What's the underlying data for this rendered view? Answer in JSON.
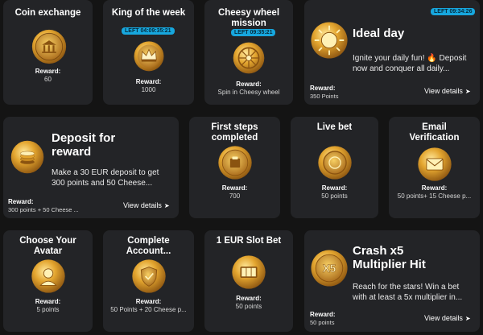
{
  "cards": [
    {
      "title": "Coin exchange",
      "reward_label": "Reward:",
      "reward_value": "60",
      "medal_icon": "bank-medal-icon"
    },
    {
      "title": "King of the week",
      "timer": "LEFT 04:09:35:21",
      "reward_label": "Reward:",
      "reward_value": "1000",
      "medal_icon": "crown-medal-icon"
    },
    {
      "title": "Cheesy wheel mission",
      "timer": "LEFT 09:35:21",
      "reward_label": "Reward:",
      "reward_value": "Spin in Cheesy wheel",
      "medal_icon": "wheel-medal-icon"
    },
    {
      "title": "Ideal day",
      "timer": "LEFT 09:34:26",
      "description": "Ignite your daily fun! 🔥 Deposit now and conquer all daily...",
      "reward_label": "Reward:",
      "reward_value": "350 Points",
      "details": "View details",
      "medal_icon": "sun-medal-icon"
    },
    {
      "title": "Deposit for reward",
      "description": "Make a 30 EUR deposit to get 300 points and 50 Cheese...",
      "reward_label": "Reward:",
      "reward_value": "300 points + 50 Cheese ...",
      "details": "View details",
      "medal_icon": "coins-medal-icon"
    },
    {
      "title": "First steps completed",
      "reward_label": "Reward:",
      "reward_value": "700",
      "medal_icon": "footprint-medal-icon"
    },
    {
      "title": "Live bet",
      "reward_label": "Reward:",
      "reward_value": "50 points",
      "medal_icon": "chip-medal-icon"
    },
    {
      "title": "Email Verification",
      "reward_label": "Reward:",
      "reward_value": "50 points+ 15 Cheese p...",
      "medal_icon": "envelope-medal-icon"
    },
    {
      "title": "Choose Your Avatar",
      "reward_label": "Reward:",
      "reward_value": "5 points",
      "medal_icon": "avatar-medal-icon"
    },
    {
      "title": "Complete Account...",
      "reward_label": "Reward:",
      "reward_value": "50 Points + 20 Cheese p...",
      "medal_icon": "shield-medal-icon"
    },
    {
      "title": "1 EUR Slot Bet",
      "reward_label": "Reward:",
      "reward_value": "50 points",
      "medal_icon": "slot-medal-icon"
    },
    {
      "title": "Crash x5 Multiplier Hit",
      "badge": "X5",
      "description": "Reach for the stars! Win a bet with at least a 5x multiplier in...",
      "reward_label": "Reward:",
      "reward_value": "50 points",
      "details": "View details",
      "medal_icon": "x5-medal-icon"
    }
  ],
  "colors": {
    "card_bg": "#232427",
    "page_bg": "#141414",
    "timer_bg": "#17a7de",
    "gold": "#d9a028"
  }
}
